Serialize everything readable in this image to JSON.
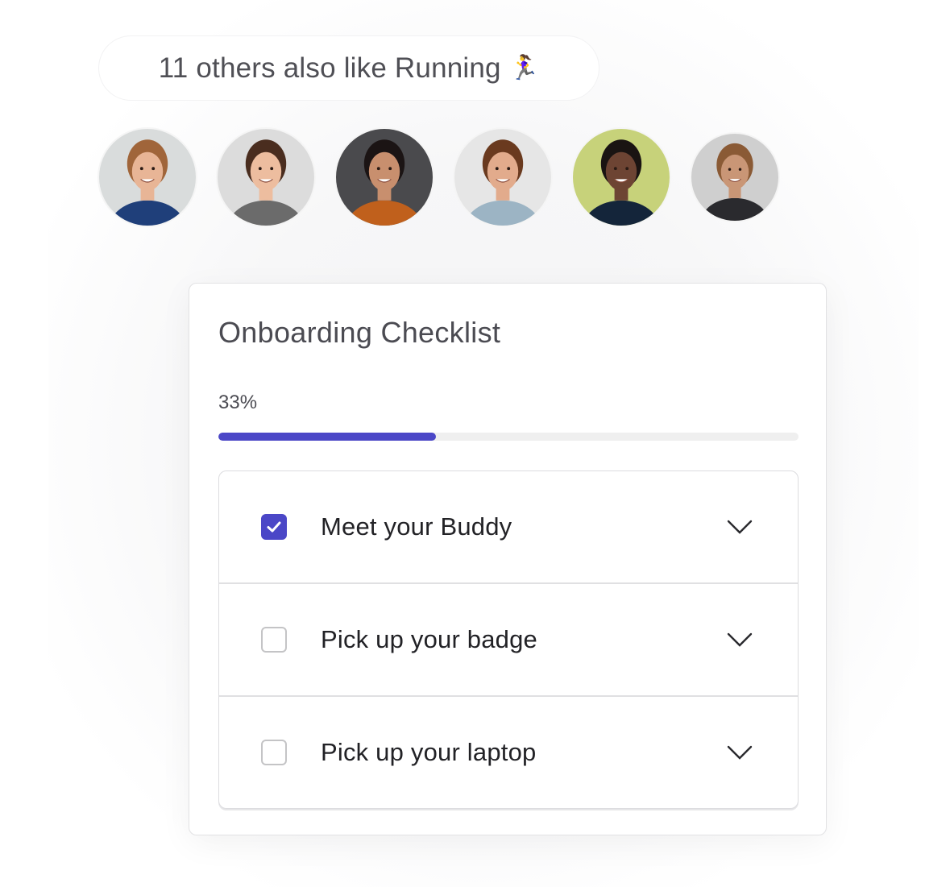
{
  "social": {
    "text": "11 others also like Running",
    "emoji": "🏃‍♀️",
    "emoji_name": "woman-running-icon"
  },
  "avatars": [
    {
      "name": "avatar-man-blonde",
      "skin": "#e8b596",
      "hair": "#a0653a",
      "shirt": "#1f3f7a",
      "bg": "#d9dcdc"
    },
    {
      "name": "avatar-woman-striped",
      "skin": "#edbd9f",
      "hair": "#4a2d1f",
      "shirt": "#6b6b6b",
      "bg": "#dcdcdc"
    },
    {
      "name": "avatar-woman-curly",
      "skin": "#c88f6e",
      "hair": "#1b1414",
      "shirt": "#c0601c",
      "bg": "#4a4a4d"
    },
    {
      "name": "avatar-man-glasses",
      "skin": "#e2ab8c",
      "hair": "#6a3a1f",
      "shirt": "#9cb4c4",
      "bg": "#e6e6e6"
    },
    {
      "name": "avatar-woman-afro",
      "skin": "#6d4433",
      "hair": "#1a1412",
      "shirt": "#14253a",
      "bg": "#c7d27a"
    },
    {
      "name": "avatar-woman-plaid",
      "skin": "#c99676",
      "hair": "#8a5a35",
      "shirt": "#2a2a2e",
      "bg": "#cfcfcf"
    }
  ],
  "checklist": {
    "title": "Onboarding Checklist",
    "progress_label": "33%",
    "progress_value": 0.375,
    "accent_color": "#4b47c7",
    "items": [
      {
        "label": "Meet your Buddy",
        "checked": true
      },
      {
        "label": "Pick up your badge",
        "checked": false
      },
      {
        "label": "Pick up your laptop",
        "checked": false
      }
    ]
  }
}
